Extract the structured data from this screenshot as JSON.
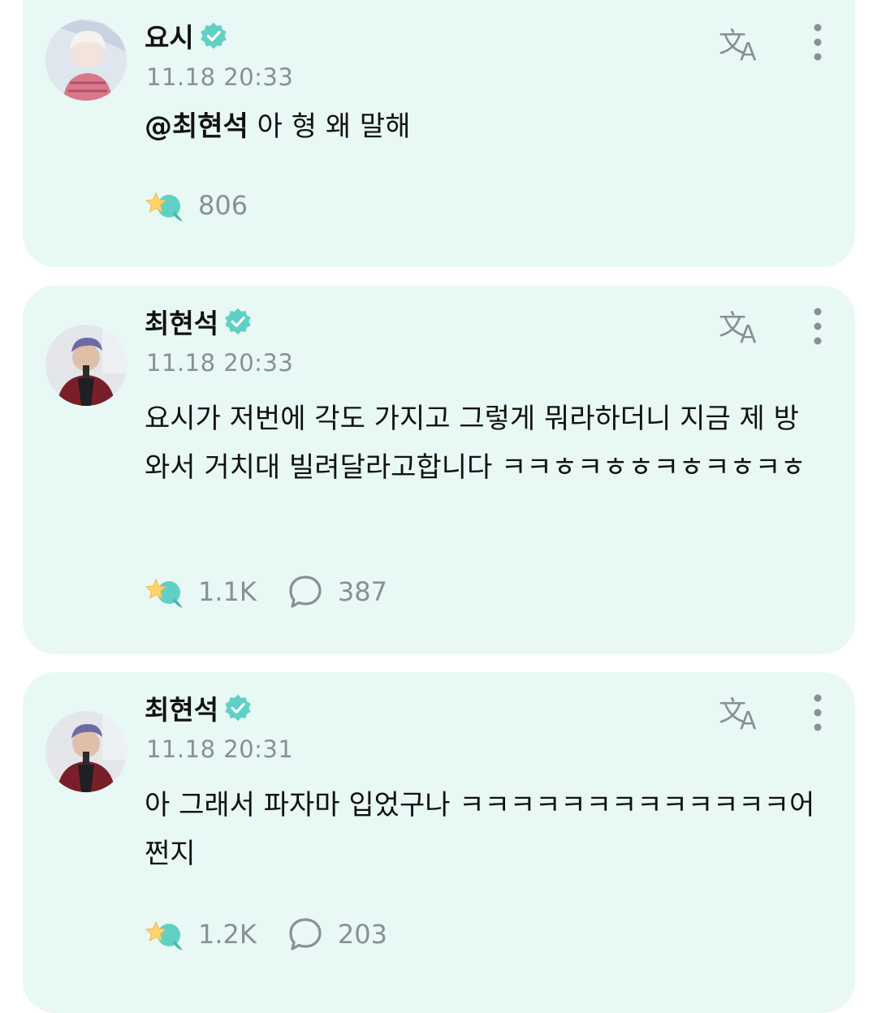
{
  "colors": {
    "card_bg": "#e8f8f5",
    "accent": "#5fd1c4",
    "muted_text": "#8a8f93"
  },
  "posts": [
    {
      "author": "요시",
      "time": "11.18 20:33",
      "mention": "@최현석",
      "text": " 아 형 왜 말해",
      "likes": "806",
      "comments": null
    },
    {
      "author": "최현석",
      "time": "11.18 20:33",
      "text": "요시가 저번에 각도 가지고 그렇게 뭐라하더니 지금 제 방와서 거치대 빌려달라고합니다 ㅋㅋㅎㅋㅎㅎㅋㅎㅋㅎㅋㅎ",
      "likes": "1.1K",
      "comments": "387"
    },
    {
      "author": "최현석",
      "time": "11.18 20:31",
      "text": "아 그래서 파자마 입었구나 ㅋㅋㅋㅋㅋㅋㅋㅋㅋㅋㅋㅋㅋ어쩐지",
      "likes": "1.2K",
      "comments": "203"
    }
  ],
  "icons": {
    "verified": "verified-badge-icon",
    "translate": "translate-icon",
    "more": "more-vertical-icon",
    "like": "star-bubble-like-icon",
    "comment": "comment-bubble-icon"
  }
}
